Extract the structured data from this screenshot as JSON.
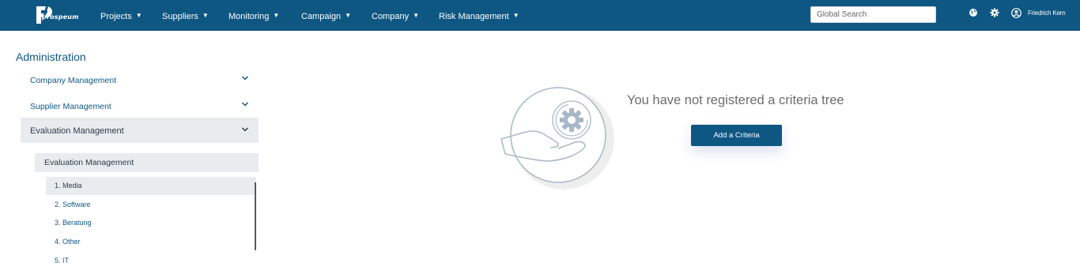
{
  "header": {
    "logo_text": "prospeum",
    "nav": [
      {
        "label": "Projects"
      },
      {
        "label": "Suppliers"
      },
      {
        "label": "Monitoring"
      },
      {
        "label": "Campaign"
      },
      {
        "label": "Company"
      },
      {
        "label": "Risk Management"
      }
    ],
    "search_placeholder": "Global Search",
    "icons": [
      "globe-icon",
      "gear-icon",
      "user-icon"
    ],
    "user_name": "Friedrich Kern"
  },
  "sidebar": {
    "title": "Administration",
    "items": [
      {
        "label": "Company Management",
        "expanded": false
      },
      {
        "label": "Supplier Management",
        "expanded": false
      },
      {
        "label": "Evaluation Management",
        "expanded": true
      }
    ],
    "submenu_title": "Evaluation Management",
    "sub_items": [
      {
        "label": "1. Media",
        "selected": true
      },
      {
        "label": "2. Software"
      },
      {
        "label": "3. Beratung"
      },
      {
        "label": "4. Other"
      },
      {
        "label": "5. IT"
      }
    ]
  },
  "main": {
    "empty_message": "You have not registered a criteria tree",
    "add_button_label": "Add a Criteria",
    "illustration": "hand-with-gear-icon"
  },
  "colors": {
    "header_bg": "#0f5783",
    "accent": "#0f5783",
    "active_bg": "#e9ecef",
    "muted_text": "#6d6d6d"
  }
}
